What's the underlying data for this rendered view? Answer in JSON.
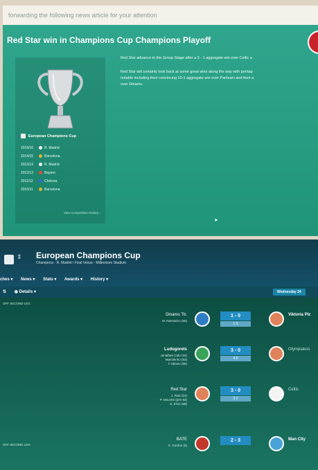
{
  "news": {
    "forward_text": "forwarding the following news article for your attention",
    "title": "Red Star win in Champions Cup Champions Playoff",
    "cup_name": "European Champions Cup",
    "winners": [
      {
        "season": "2015/16",
        "club": "R. Madrid",
        "badge_color": "#f2f2f2"
      },
      {
        "season": "2014/15",
        "club": "Barcelona",
        "badge_color": "#e0b43b"
      },
      {
        "season": "2013/14",
        "club": "R. Madrid",
        "badge_color": "#f2f2f2"
      },
      {
        "season": "2012/13",
        "club": "Bayern",
        "badge_color": "#e34b3b"
      },
      {
        "season": "2011/12",
        "club": "Chelsea",
        "badge_color": "#3a6bd0"
      },
      {
        "season": "2010/11",
        "club": "Barcelona",
        "badge_color": "#e0b43b"
      }
    ],
    "view_history": "View Competition History ›",
    "paragraph1": "Red Star advance to the Group Stage after a 3 - 1 aggregate win over Celtic a",
    "paragraph2_lines": [
      "Red Star will certainly look back at some great wins along the way with perhap",
      "notable including their convincing 10-1 aggregate win over Partizani and their a",
      "over Dinamo."
    ]
  },
  "competition": {
    "title": "European Champions Cup",
    "subtitle": "Champions - R. Madrid / Final Venue - Millennium Stadium",
    "menu": [
      "ches ▾",
      "News ▾",
      "Stats ▾",
      "Awards ▾",
      "History ▾"
    ],
    "details_label": "Details ▾",
    "date_label": "Wednesday 24",
    "round_labels": [
      "OFF SECOND LEG",
      "OFF SECOND LEG"
    ]
  },
  "fixtures": [
    {
      "home": "Dinamo Tb.",
      "home_bold": false,
      "scorers": [
        "M. Nannarico (65)"
      ],
      "score": "1 - 0",
      "agg": "1 3",
      "away": "Viktoria Plz",
      "away_bold": true,
      "home_crest": "#2f7ec4",
      "away_crest": "#e0835b"
    },
    {
      "home": "Ludogorets",
      "home_bold": true,
      "scorers": [
        "Jonathan Cafu (34)",
        "Marcelinho (53)",
        "T. Miroev (86)"
      ],
      "score": "3 - 0",
      "agg": "4 0",
      "away": "Olympiakos",
      "away_bold": false,
      "home_crest": "#39a35a",
      "away_crest": "#e0835b"
    },
    {
      "home": "Red Star",
      "home_bold": false,
      "scorers": [
        "J. Ruiz (24)",
        "P. Mouche (pen 53)",
        "S. Ervic (68)"
      ],
      "score": "3 - 0",
      "agg": "3 1",
      "away": "Celtic",
      "away_bold": false,
      "home_crest": "#e0835b",
      "away_crest": "#f4f4f4"
    },
    {
      "home": "BATE",
      "home_bold": false,
      "scorers": [
        "C. Gordon (5)"
      ],
      "score": "2 - 3",
      "agg": "",
      "away": "Man City",
      "away_bold": true,
      "home_crest": "#c0392b",
      "away_crest": "#4aa3d8"
    }
  ],
  "colors": {
    "panel": "#2fa68d",
    "score_box": "#238dc2",
    "alert": "#c8232a"
  }
}
